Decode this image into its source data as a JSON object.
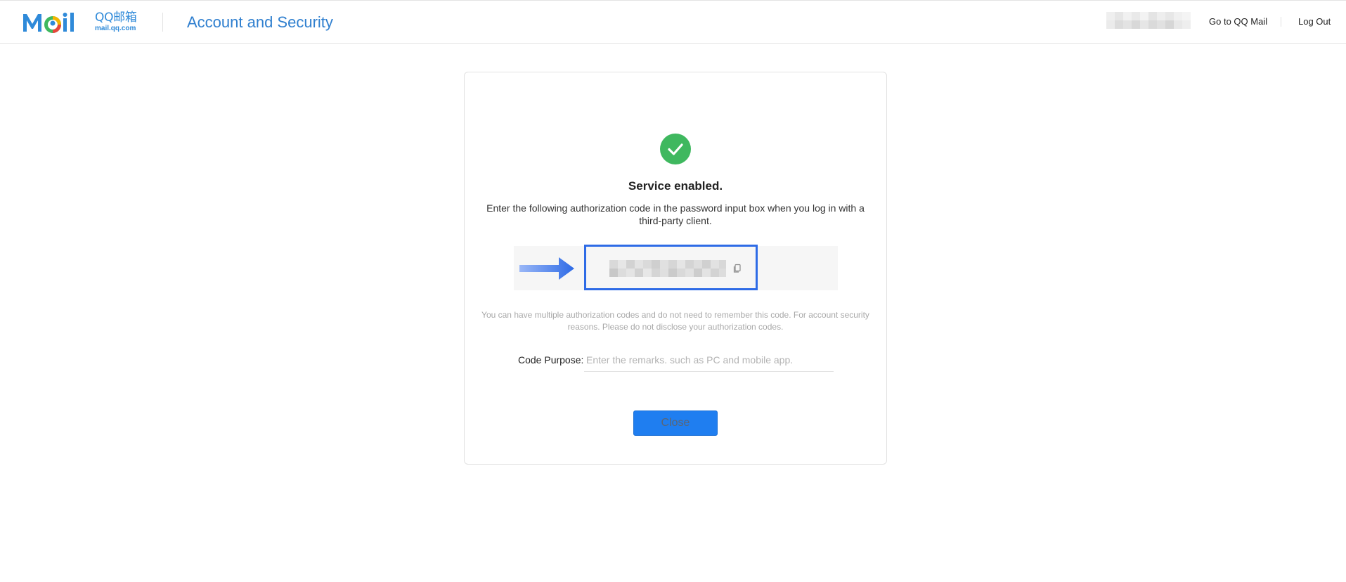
{
  "header": {
    "logo_cn": "QQ邮箱",
    "logo_url": "mail.qq.com",
    "title": "Account and Security",
    "go_to_mail": "Go to QQ Mail",
    "log_out": "Log Out"
  },
  "card": {
    "status_icon": "check-circle-icon",
    "status_title": "Service enabled.",
    "instructions": "Enter the following authorization code in the password input box when you log in with a third-party client.",
    "note": "You can have multiple authorization codes and do not need to remember this code. For account security reasons. Please do not disclose your authorization codes.",
    "purpose_label": "Code Purpose:",
    "purpose_placeholder": "Enter the remarks. such as PC and mobile app.",
    "purpose_value": "",
    "close_label": "Close"
  },
  "colors": {
    "accent": "#2f7fcf",
    "success": "#3fb85f",
    "highlight_border": "#2e6be6",
    "button": "#1f7ef0"
  }
}
